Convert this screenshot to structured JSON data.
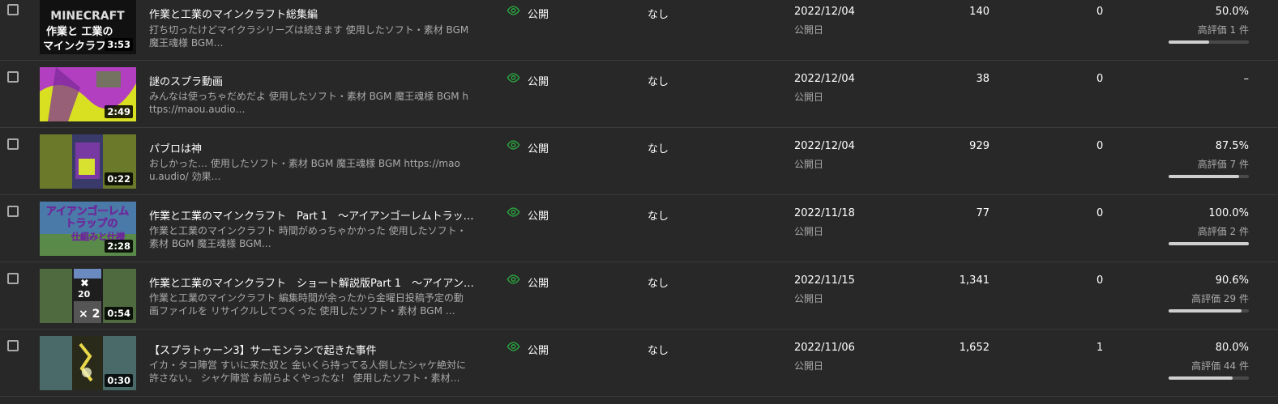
{
  "videos": [
    {
      "title": "作業と工業のマインクラフト総集編",
      "description": "打ち切ったけどマイクラシリーズは続きます 使用したソフト・素材 BGM 魔王魂様 BGM…",
      "duration": "3:53",
      "visibility": "公開",
      "restrictions": "なし",
      "date": "2022/12/04",
      "date_label": "公開日",
      "views": "140",
      "comments": "0",
      "likes_pct": "50.0%",
      "likes_count": "高評価 1 件",
      "likes_ratio": 0.5,
      "thumb_text": "作業と 工業の マインクラフ",
      "thumb_brand": "MINECRAFT"
    },
    {
      "title": "謎のスプラ動画",
      "description": "みんなは使っちゃだめだよ 使用したソフト・素材 BGM 魔王魂様 BGM https://maou.audio…",
      "duration": "2:49",
      "visibility": "公開",
      "restrictions": "なし",
      "date": "2022/12/04",
      "date_label": "公開日",
      "views": "38",
      "comments": "0",
      "likes_pct": "–",
      "likes_count": "",
      "likes_ratio": null
    },
    {
      "title": "パブロは神",
      "description": "おしかった… 使用したソフト・素材 BGM 魔王魂様 BGM https://maou.audio/ 効果…",
      "duration": "0:22",
      "visibility": "公開",
      "restrictions": "なし",
      "date": "2022/12/04",
      "date_label": "公開日",
      "views": "929",
      "comments": "0",
      "likes_pct": "87.5%",
      "likes_count": "高評価 7 件",
      "likes_ratio": 0.875
    },
    {
      "title": "作業と工業のマインクラフト　Part 1　～アイアンゴーレムトラッ…",
      "description": "作業と工業のマインクラフト 時間がめっちゃかかった 使用したソフト・素材 BGM 魔王魂様 BGM…",
      "duration": "2:28",
      "visibility": "公開",
      "restrictions": "なし",
      "date": "2022/11/18",
      "date_label": "公開日",
      "views": "77",
      "comments": "0",
      "likes_pct": "100.0%",
      "likes_count": "高評価 2 件",
      "likes_ratio": 1.0,
      "thumb_text": "アイアンゴーレム トラップの 仕組みと仕様"
    },
    {
      "title": "作業と工業のマインクラフト　ショート解説版Part 1　～アイアン…",
      "description": "作業と工業のマインクラフト 編集時間が余ったから金曜日投稿予定の動画ファイルを リサイクルしてつくった 使用したソフト・素材 BGM …",
      "duration": "0:54",
      "visibility": "公開",
      "restrictions": "なし",
      "date": "2022/11/15",
      "date_label": "公開日",
      "views": "1,341",
      "comments": "0",
      "likes_pct": "90.6%",
      "likes_count": "高評価 29 件",
      "likes_ratio": 0.906,
      "thumb_text": "× 20 × 2"
    },
    {
      "title": "【スプラトゥーン3】サーモンランで起きた事件",
      "description": "イカ・タコ陣営 すいに来た奴と 金いくら持ってる人倒したシャケ絶対に許さない。 シャケ陣営 お前らよくやったな！ 使用したソフト・素材…",
      "duration": "0:30",
      "visibility": "公開",
      "restrictions": "なし",
      "date": "2022/11/06",
      "date_label": "公開日",
      "views": "1,652",
      "comments": "1",
      "likes_pct": "80.0%",
      "likes_count": "高評価 44 件",
      "likes_ratio": 0.8
    }
  ],
  "colors": {
    "background": "#282828",
    "visibility_icon": "#2ba640",
    "bar_fill": "#cfcfcf",
    "bar_track": "#4a4a4a"
  },
  "icons": {
    "visibility": "eye-icon",
    "checkbox": "checkbox-icon"
  }
}
